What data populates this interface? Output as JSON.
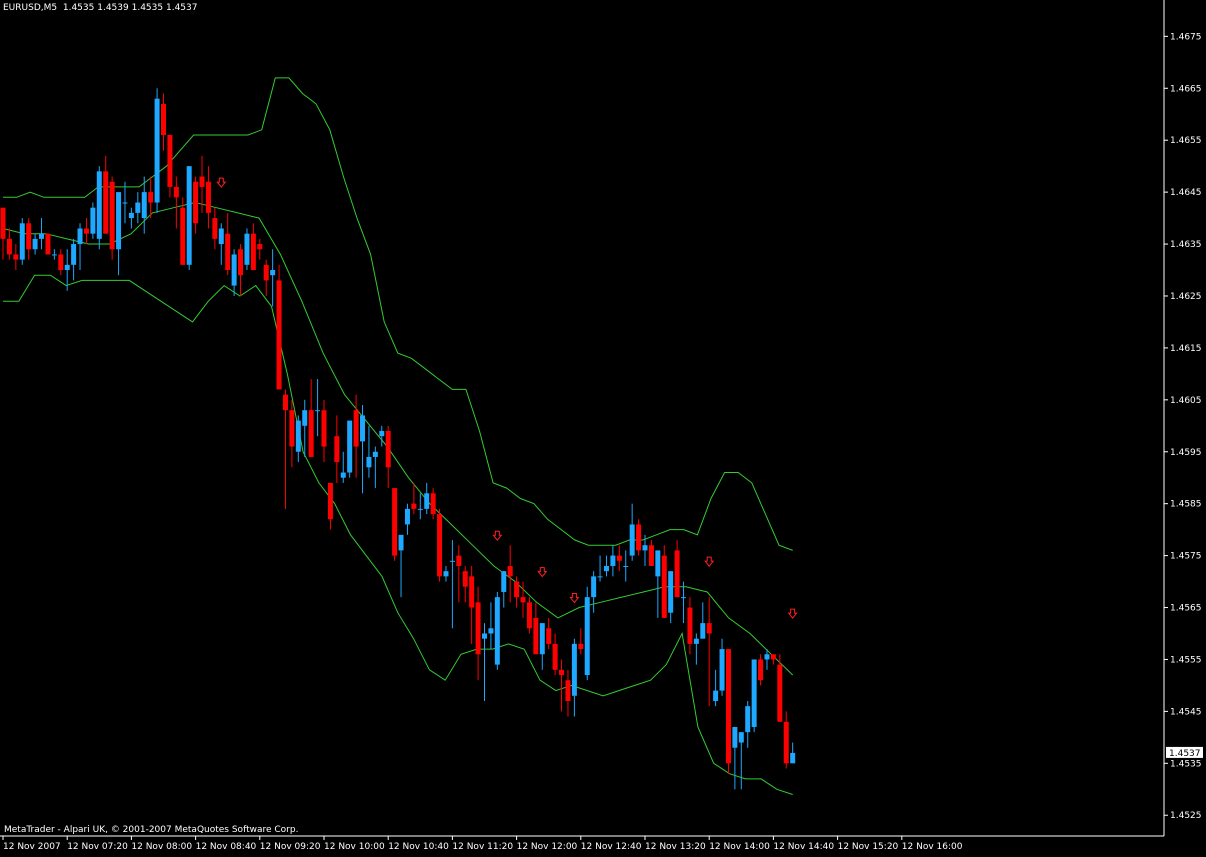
{
  "header": {
    "symbol": "EURUSD,M5",
    "open": "1.4535",
    "high": "1.4539",
    "low": "1.4535",
    "close": "1.4537"
  },
  "copyright": "MetaTrader - Alpari UK, © 2001-2007 MetaQuotes Software Corp.",
  "current_price_label": "1.4537",
  "colors": {
    "background": "#000000",
    "axis": "#ffffff",
    "bull": "#1ea8ff",
    "bear": "#ff0000",
    "bands": "#33cc33",
    "arrow": "#ff2020"
  },
  "chart_data": {
    "type": "candlestick",
    "y_ticks": [
      "1.4525",
      "1.4535",
      "1.4545",
      "1.4555",
      "1.4565",
      "1.4575",
      "1.4585",
      "1.4595",
      "1.4605",
      "1.4615",
      "1.4625",
      "1.4635",
      "1.4645",
      "1.4655",
      "1.4665",
      "1.4675"
    ],
    "x_ticks": [
      "12 Nov 2007",
      "12 Nov 07:20",
      "12 Nov 08:00",
      "12 Nov 08:40",
      "12 Nov 09:20",
      "12 Nov 10:00",
      "12 Nov 10:40",
      "12 Nov 11:20",
      "12 Nov 12:00",
      "12 Nov 12:40",
      "12 Nov 13:20",
      "12 Nov 14:00",
      "12 Nov 14:40",
      "12 Nov 15:20",
      "12 Nov 16:00"
    ],
    "ylim": [
      1.4521,
      1.4682
    ],
    "last_close": 1.4537,
    "candles": [
      [
        1.4642,
        1.4642,
        1.4632,
        1.4636
      ],
      [
        1.4636,
        1.4638,
        1.4632,
        1.4633
      ],
      [
        1.4633,
        1.4635,
        1.463,
        1.4632
      ],
      [
        1.4632,
        1.464,
        1.4631,
        1.4639
      ],
      [
        1.4639,
        1.464,
        1.4632,
        1.4634
      ],
      [
        1.4634,
        1.4637,
        1.4633,
        1.4636
      ],
      [
        1.4636,
        1.464,
        1.4634,
        1.4637
      ],
      [
        1.4637,
        1.4637,
        1.4633,
        1.4633
      ],
      [
        1.4633,
        1.4634,
        1.4632,
        1.4633
      ],
      [
        1.4633,
        1.4634,
        1.4629,
        1.463
      ],
      [
        1.463,
        1.4634,
        1.4626,
        1.4631
      ],
      [
        1.4631,
        1.4636,
        1.4628,
        1.4635
      ],
      [
        1.4635,
        1.4639,
        1.463,
        1.4638
      ],
      [
        1.4638,
        1.464,
        1.4635,
        1.4637
      ],
      [
        1.4637,
        1.4643,
        1.4636,
        1.4642
      ],
      [
        1.4636,
        1.465,
        1.4634,
        1.4649
      ],
      [
        1.4649,
        1.4652,
        1.4637,
        1.4637
      ],
      [
        1.4647,
        1.4648,
        1.4632,
        1.4634
      ],
      [
        1.4634,
        1.4645,
        1.4629,
        1.4645
      ],
      [
        1.4643,
        1.4647,
        1.4639,
        1.4643
      ],
      [
        1.464,
        1.4642,
        1.4638,
        1.4641
      ],
      [
        1.4641,
        1.4645,
        1.4639,
        1.4643
      ],
      [
        1.464,
        1.4648,
        1.4637,
        1.4645
      ],
      [
        1.4645,
        1.4648,
        1.464,
        1.4643
      ],
      [
        1.4643,
        1.4665,
        1.4641,
        1.4663
      ],
      [
        1.4662,
        1.4664,
        1.4653,
        1.4656
      ],
      [
        1.4656,
        1.4656,
        1.4644,
        1.4646
      ],
      [
        1.4646,
        1.4648,
        1.4638,
        1.4644
      ],
      [
        1.4642,
        1.4644,
        1.4631,
        1.4631
      ],
      [
        1.4631,
        1.465,
        1.463,
        1.465
      ],
      [
        1.4647,
        1.4648,
        1.4637,
        1.4639
      ],
      [
        1.4648,
        1.4652,
        1.4641,
        1.4646
      ],
      [
        1.4647,
        1.465,
        1.4638,
        1.4641
      ],
      [
        1.464,
        1.4642,
        1.4634,
        1.4636
      ],
      [
        1.4635,
        1.4639,
        1.4631,
        1.4638
      ],
      [
        1.4637,
        1.4641,
        1.4629,
        1.463
      ],
      [
        1.4627,
        1.4634,
        1.4625,
        1.4633
      ],
      [
        1.4634,
        1.4635,
        1.4625,
        1.4629
      ],
      [
        1.4631,
        1.4638,
        1.463,
        1.4637
      ],
      [
        1.4637,
        1.4639,
        1.463,
        1.463
      ],
      [
        1.4635,
        1.4636,
        1.4632,
        1.4634
      ],
      [
        1.4631,
        1.4632,
        1.4625,
        1.4628
      ],
      [
        1.4629,
        1.4634,
        1.4623,
        1.463
      ],
      [
        1.4628,
        1.4631,
        1.4607,
        1.4607
      ],
      [
        1.4606,
        1.4607,
        1.4584,
        1.4603
      ],
      [
        1.4603,
        1.4605,
        1.4592,
        1.4596
      ],
      [
        1.4595,
        1.4602,
        1.4593,
        1.4601
      ],
      [
        1.46,
        1.4605,
        1.4594,
        1.4603
      ],
      [
        1.4603,
        1.4609,
        1.4594,
        1.4594
      ],
      [
        1.4603,
        1.4609,
        1.4598,
        1.4603
      ],
      [
        1.4603,
        1.4605,
        1.4593,
        1.4596
      ],
      [
        1.4589,
        1.4589,
        1.458,
        1.4582
      ],
      [
        1.4598,
        1.4602,
        1.4589,
        1.4593
      ],
      [
        1.459,
        1.4595,
        1.4589,
        1.4591
      ],
      [
        1.4591,
        1.4596,
        1.459,
        1.4601
      ],
      [
        1.4603,
        1.4606,
        1.459,
        1.4596
      ],
      [
        1.4597,
        1.4604,
        1.4587,
        1.4602
      ],
      [
        1.4592,
        1.46,
        1.459,
        1.4594
      ],
      [
        1.4594,
        1.4596,
        1.4588,
        1.4595
      ],
      [
        1.4598,
        1.46,
        1.4596,
        1.4599
      ],
      [
        1.4599,
        1.46,
        1.4588,
        1.4592
      ],
      [
        1.4588,
        1.4588,
        1.4574,
        1.4575
      ],
      [
        1.4576,
        1.4576,
        1.4567,
        1.4579
      ],
      [
        1.4581,
        1.4585,
        1.4579,
        1.4584
      ],
      [
        1.4585,
        1.4589,
        1.4583,
        1.4584
      ],
      [
        1.4584,
        1.4587,
        1.4582,
        1.4584
      ],
      [
        1.4584,
        1.4589,
        1.4583,
        1.4587
      ],
      [
        1.4587,
        1.4588,
        1.4582,
        1.4583
      ],
      [
        1.4583,
        1.4584,
        1.457,
        1.4571
      ],
      [
        1.4571,
        1.4573,
        1.457,
        1.4572
      ],
      [
        1.4574,
        1.4578,
        1.4561,
        1.4574
      ],
      [
        1.4575,
        1.4577,
        1.4566,
        1.4573
      ],
      [
        1.4572,
        1.4573,
        1.4566,
        1.4569
      ],
      [
        1.4571,
        1.4573,
        1.4558,
        1.4565
      ],
      [
        1.4566,
        1.4569,
        1.4551,
        1.4556
      ],
      [
        1.4559,
        1.4562,
        1.4547,
        1.456
      ],
      [
        1.456,
        1.4566,
        1.4557,
        1.4561
      ],
      [
        1.4554,
        1.4568,
        1.4553,
        1.4567
      ],
      [
        1.4568,
        1.4572,
        1.4565,
        1.4572
      ],
      [
        1.4573,
        1.4577,
        1.4566,
        1.4571
      ],
      [
        1.457,
        1.4571,
        1.4565,
        1.4567
      ],
      [
        1.4567,
        1.457,
        1.4563,
        1.4566
      ],
      [
        1.4566,
        1.4567,
        1.456,
        1.4561
      ],
      [
        1.4563,
        1.4566,
        1.4556,
        1.4556
      ],
      [
        1.4556,
        1.456,
        1.4553,
        1.4562
      ],
      [
        1.4561,
        1.4563,
        1.4557,
        1.4558
      ],
      [
        1.4558,
        1.456,
        1.4552,
        1.4553
      ],
      [
        1.4553,
        1.4555,
        1.4545,
        1.4552
      ],
      [
        1.4551,
        1.4553,
        1.4544,
        1.4547
      ],
      [
        1.4548,
        1.4559,
        1.4544,
        1.4558
      ],
      [
        1.4558,
        1.4561,
        1.4556,
        1.4557
      ],
      [
        1.4552,
        1.4569,
        1.4551,
        1.4567
      ],
      [
        1.4567,
        1.4572,
        1.4564,
        1.4571
      ],
      [
        1.4571,
        1.4575,
        1.457,
        1.4571
      ],
      [
        1.4572,
        1.4575,
        1.4571,
        1.4573
      ],
      [
        1.4573,
        1.4577,
        1.4571,
        1.4575
      ],
      [
        1.4575,
        1.4577,
        1.4572,
        1.4574
      ],
      [
        1.4573,
        1.4576,
        1.457,
        1.4573
      ],
      [
        1.4575,
        1.4585,
        1.4574,
        1.4581
      ],
      [
        1.4581,
        1.4582,
        1.4575,
        1.4576
      ],
      [
        1.4576,
        1.4579,
        1.4573,
        1.4577
      ],
      [
        1.4577,
        1.4578,
        1.4573,
        1.4573
      ],
      [
        1.4571,
        1.4575,
        1.4563,
        1.4576
      ],
      [
        1.4575,
        1.4577,
        1.4563,
        1.4563
      ],
      [
        1.4564,
        1.4572,
        1.4562,
        1.4572
      ],
      [
        1.4576,
        1.4578,
        1.4567,
        1.4567
      ],
      [
        1.4567,
        1.457,
        1.4562,
        1.4567
      ],
      [
        1.4565,
        1.4567,
        1.4556,
        1.4558
      ],
      [
        1.4558,
        1.456,
        1.4554,
        1.4559
      ],
      [
        1.4559,
        1.4566,
        1.4559,
        1.4562
      ],
      [
        1.4562,
        1.4567,
        1.4546,
        1.456
      ],
      [
        1.4547,
        1.4553,
        1.4546,
        1.4549
      ],
      [
        1.4549,
        1.4559,
        1.4548,
        1.4557
      ],
      [
        1.4557,
        1.4557,
        1.4533,
        1.4535
      ],
      [
        1.4538,
        1.4541,
        1.453,
        1.4542
      ],
      [
        1.4539,
        1.4541,
        1.453,
        1.4541
      ],
      [
        1.4541,
        1.4547,
        1.4538,
        1.4546
      ],
      [
        1.4542,
        1.4554,
        1.4541,
        1.4555
      ],
      [
        1.4555,
        1.4556,
        1.455,
        1.4551
      ],
      [
        1.4555,
        1.4557,
        1.4553,
        1.4556
      ],
      [
        1.4556,
        1.4556,
        1.4554,
        1.4555
      ],
      [
        1.4554,
        1.4556,
        1.4543,
        1.4543
      ],
      [
        1.4543,
        1.4545,
        1.4534,
        1.4535
      ],
      [
        1.4535,
        1.4539,
        1.4535,
        1.4537
      ]
    ],
    "bollinger": {
      "upper": [
        1.4644,
        1.4644,
        1.4645,
        1.4644,
        1.4644,
        1.4644,
        1.4644,
        1.4646,
        1.4646,
        1.4646,
        1.4646,
        1.4648,
        1.465,
        1.4653,
        1.4656,
        1.4656,
        1.4656,
        1.4656,
        1.4656,
        1.4657,
        1.4667,
        1.4667,
        1.4664,
        1.4662,
        1.4657,
        1.4648,
        1.464,
        1.4633,
        1.462,
        1.4614,
        1.4613,
        1.4611,
        1.4609,
        1.4607,
        1.4607,
        1.4599,
        1.4589,
        1.4588,
        1.4586,
        1.4585,
        1.4582,
        1.458,
        1.4578,
        1.4577,
        1.4577,
        1.4577,
        1.4578,
        1.4578,
        1.4579,
        1.458,
        1.458,
        1.4579,
        1.4586,
        1.4591,
        1.4591,
        1.4589,
        1.4583,
        1.4577,
        1.4576
      ],
      "middle": [
        1.4638,
        1.4637,
        1.4637,
        1.4636,
        1.4635,
        1.4635,
        1.4637,
        1.4641,
        1.4642,
        1.4643,
        1.4642,
        1.4641,
        1.464,
        1.4633,
        1.4624,
        1.4614,
        1.4606,
        1.4601,
        1.4596,
        1.459,
        1.4585,
        1.4581,
        1.4577,
        1.4573,
        1.457,
        1.4566,
        1.4563,
        1.4565,
        1.4566,
        1.4567,
        1.4568,
        1.4569,
        1.4569,
        1.4568,
        1.4563,
        1.456,
        1.4556,
        1.4552
      ],
      "lower": [
        1.4624,
        1.4624,
        1.4629,
        1.4629,
        1.4627,
        1.4628,
        1.4628,
        1.4628,
        1.4628,
        1.4626,
        1.4624,
        1.4622,
        1.462,
        1.4624,
        1.4627,
        1.4625,
        1.4627,
        1.4623,
        1.461,
        1.4595,
        1.4589,
        1.4585,
        1.4579,
        1.4575,
        1.4571,
        1.4564,
        1.4559,
        1.4553,
        1.4551,
        1.4556,
        1.4557,
        1.4557,
        1.4558,
        1.4557,
        1.4551,
        1.4549,
        1.455,
        1.4549,
        1.4548,
        1.4549,
        1.455,
        1.4551,
        1.4554,
        1.456,
        1.4542,
        1.4535,
        1.4533,
        1.4532,
        1.4532,
        1.453,
        1.4529
      ]
    },
    "fractal_arrows": [
      1.4645,
      1.4577,
      1.457,
      1.4565,
      1.4572,
      1.4562
    ]
  }
}
